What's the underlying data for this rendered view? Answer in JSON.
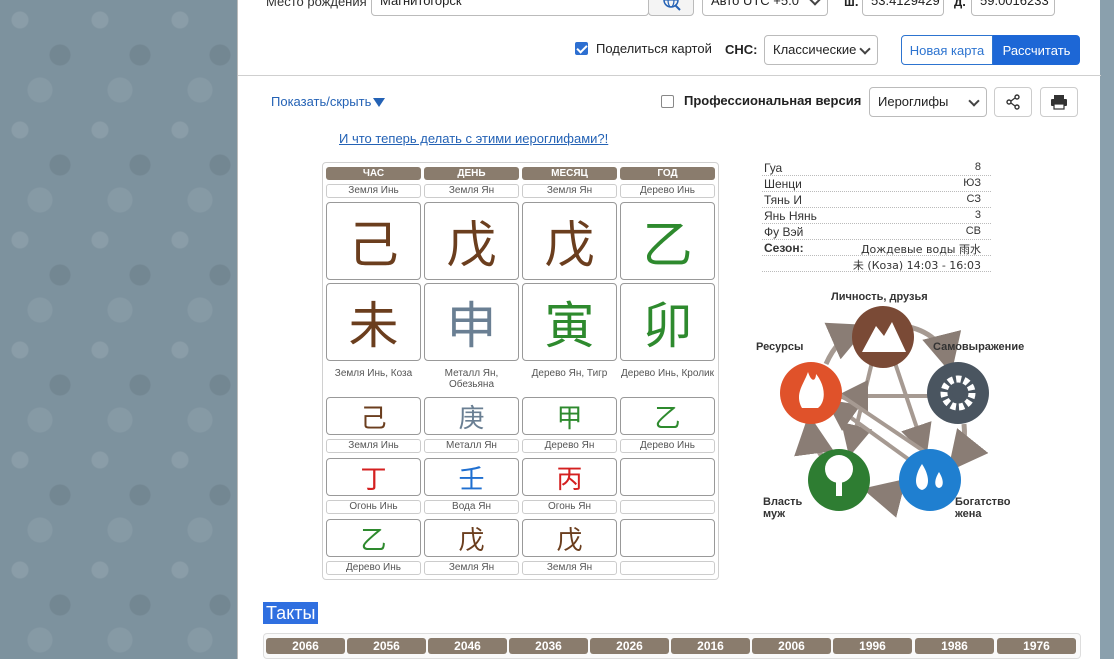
{
  "form": {
    "place_label": "Место рождения",
    "place_value": "Магнитогорск",
    "timezone_value": "Авто UTC +5.0",
    "lat_label": "ш.",
    "lat_value": "53.4129429",
    "lon_label": "д.",
    "lon_value": "59.0016233",
    "share_label": "Поделиться картой",
    "share_checked": true,
    "sns_label": "СНС:",
    "sns_value": "Классические",
    "new_map": "Новая карта",
    "calculate": "Рассчитать"
  },
  "toolbar": {
    "show_hide": "Показать/скрыть",
    "pro_label": "Профессиональная версия",
    "view_value": "Иероглифы"
  },
  "link_what": "И что теперь делать с этими иероглифами?!",
  "pillars": {
    "headers": [
      "ЧАС",
      "ДЕНЬ",
      "МЕСЯЦ",
      "ГОД"
    ],
    "stem_captions": [
      "Земля Инь",
      "Земля Ян",
      "Земля Ян",
      "Дерево Инь"
    ],
    "stems": [
      {
        "char": "己",
        "color": "#6b3e1e"
      },
      {
        "char": "戊",
        "color": "#6b3e1e"
      },
      {
        "char": "戊",
        "color": "#6b3e1e"
      },
      {
        "char": "乙",
        "color": "#2e8a2e"
      }
    ],
    "branches": [
      {
        "char": "未",
        "color": "#6b3e1e"
      },
      {
        "char": "申",
        "color": "#6a7f93"
      },
      {
        "char": "寅",
        "color": "#2e8a2e"
      },
      {
        "char": "卯",
        "color": "#2e8a2e"
      }
    ],
    "branch_captions": [
      "Земля Инь, Коза",
      "Металл Ян, Обезьяна",
      "Дерево Ян, Тигр",
      "Дерево Инь, Кролик"
    ],
    "hidden_rows": [
      {
        "cells": [
          {
            "char": "己",
            "color": "#6b3e1e"
          },
          {
            "char": "庚",
            "color": "#6a7f93"
          },
          {
            "char": "甲",
            "color": "#2e8a2e"
          },
          {
            "char": "乙",
            "color": "#2e8a2e"
          }
        ],
        "captions": [
          "Земля Инь",
          "Металл Ян",
          "Дерево Ян",
          "Дерево Инь"
        ]
      },
      {
        "cells": [
          {
            "char": "丁",
            "color": "#d42020"
          },
          {
            "char": "壬",
            "color": "#1f6fd0"
          },
          {
            "char": "丙",
            "color": "#d42020"
          },
          {
            "char": "",
            "color": "#000"
          }
        ],
        "captions": [
          "Огонь Инь",
          "Вода Ян",
          "Огонь Ян",
          ""
        ]
      },
      {
        "cells": [
          {
            "char": "乙",
            "color": "#2e8a2e"
          },
          {
            "char": "戊",
            "color": "#6b3e1e"
          },
          {
            "char": "戊",
            "color": "#6b3e1e"
          },
          {
            "char": "",
            "color": "#000"
          }
        ],
        "captions": [
          "Дерево Инь",
          "Земля Ян",
          "Земля Ян",
          ""
        ]
      }
    ]
  },
  "info": {
    "rows": [
      {
        "k": "Гуа",
        "v": "8"
      },
      {
        "k": "Шенци",
        "v": "ЮЗ"
      },
      {
        "k": "Тянь И",
        "v": "СЗ"
      },
      {
        "k": "Янь Нянь",
        "v": "3"
      },
      {
        "k": "Фу Вэй",
        "v": "СВ"
      }
    ],
    "season_label": "Сезон:",
    "season_value": "Дождевые воды 雨水",
    "time_value": "未 (Коза) 14:03 - 16:03"
  },
  "wheel": {
    "top": "Личность, друзья",
    "left": "Ресурсы",
    "right": "Самовыражение",
    "bottom_left_1": "Власть",
    "bottom_left_2": "муж",
    "bottom_right_1": "Богатство",
    "bottom_right_2": "жена",
    "colors": {
      "earth": "#7a4a36",
      "metal": "#4a5560",
      "water": "#1f7fd0",
      "wood": "#2e7d32",
      "fire": "#e0522a"
    }
  },
  "takty_title": "Такты",
  "years": [
    "2066",
    "2056",
    "2046",
    "2036",
    "2026",
    "2016",
    "2006",
    "1996",
    "1986",
    "1976"
  ]
}
